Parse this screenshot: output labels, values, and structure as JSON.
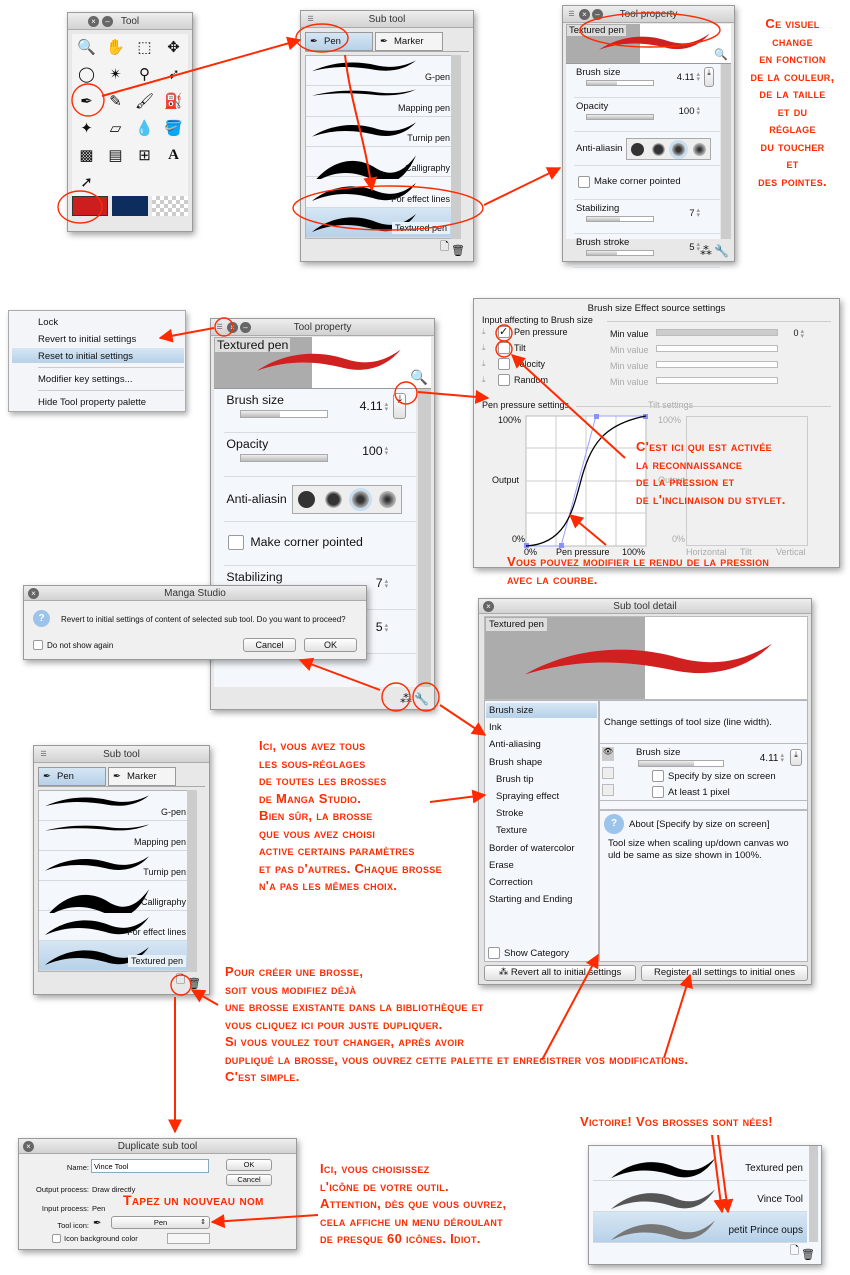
{
  "colors": {
    "annotation": "#ff2a00",
    "brush_red": "#d02020",
    "foreground": "#cc1e1e",
    "background": "#0c2d5e",
    "selection": "#c3d9ee"
  },
  "tool_palette": {
    "title": "Tool",
    "icons": [
      "zoom-icon",
      "hand-icon",
      "object-icon",
      "move-icon",
      "lasso-icon",
      "magic-wand-icon",
      "eyedropper-icon",
      "cursor-icon",
      "pen-icon",
      "pencil-icon",
      "brush-icon",
      "airbrush-icon",
      "decoration-icon",
      "eraser-icon",
      "blend-icon",
      "fill-icon",
      "gradient-icon",
      "figure-icon",
      "frame-icon",
      "text-icon",
      "correct-line-icon"
    ],
    "text_glyph": "A"
  },
  "sub_tool_top": {
    "title": "Sub tool",
    "tabs": [
      "Pen",
      "Marker"
    ],
    "items": [
      "G-pen",
      "Mapping pen",
      "Turnip pen",
      "Calligraphy",
      "For effect lines",
      "Textured pen"
    ],
    "selected": "Textured pen"
  },
  "tool_property": {
    "title": "Tool property",
    "preview_label": "Textured pen",
    "brush_size_label": "Brush size",
    "brush_size": "4.11",
    "brush_size_fill": 0.45,
    "opacity_label": "Opacity",
    "opacity": "100",
    "opacity_fill": 1.0,
    "anti_alias_label": "Anti-aliasin",
    "anti_alias_selected": 3,
    "corner_label": "Make corner pointed",
    "stabilizing_label": "Stabilizing",
    "stabilizing": "7",
    "stabilizing_fill": 0.5,
    "stroke_label": "Brush stroke",
    "stroke": "5",
    "stroke_fill": 0.45
  },
  "annotation_top": [
    "Ce visuel",
    "change",
    "en fonction",
    "de la couleur,",
    "de la taille",
    "et du",
    "réglage",
    "du toucher",
    "et",
    "des pointes."
  ],
  "menu": {
    "items": [
      "Lock",
      "Revert to initial settings",
      "Reset to initial settings",
      "Modifier key settings...",
      "Hide Tool property palette"
    ],
    "highlighted": "Reset to initial settings"
  },
  "effect_source": {
    "title": "Brush size Effect source settings",
    "group": "Input affecting to Brush size",
    "inputs": [
      {
        "label": "Pen pressure",
        "checked": true,
        "min_label": "Min value",
        "min": "0"
      },
      {
        "label": "Tilt",
        "checked": false,
        "min_label": "Min value"
      },
      {
        "label": "Velocity",
        "checked": false,
        "min_label": "Min value"
      },
      {
        "label": "Random",
        "checked": false,
        "min_label": "Min value"
      }
    ],
    "pressure_title": "Pen pressure settings",
    "tilt_title": "Tilt settings",
    "y_max": "100%",
    "y_label": "Output",
    "y_min": "0%",
    "x_min": "0%",
    "x_label": "Pen pressure",
    "x_max": "100%",
    "tilt_y_max": "100%",
    "tilt_y_label": "Output",
    "tilt_y_min": "0%",
    "tilt_x": [
      "Horizontal",
      "Tilt",
      "Vertical"
    ]
  },
  "annotation_pressure": [
    "C'est ici qui est activée",
    "la reconnaissance",
    "de la pression et",
    "de l'inclinaison du stylet."
  ],
  "annotation_curve": [
    "Vous pouvez modifier le rendu de la pression",
    "avec la courbe."
  ],
  "confirm_dialog": {
    "title": "Manga Studio",
    "message": "Revert to initial settings of content of selected sub tool.  Do you want to proceed?",
    "checkbox": "Do not show again",
    "cancel": "Cancel",
    "ok": "OK"
  },
  "sub_tool_detail": {
    "title": "Sub tool detail",
    "preview_label": "Textured pen",
    "categories": [
      "Brush size",
      "Ink",
      "Anti-aliasing",
      "Brush shape",
      "Brush tip",
      "Spraying effect",
      "Stroke",
      "Texture",
      "Border of watercolor",
      "Erase",
      "Correction",
      "Starting and Ending"
    ],
    "selected": "Brush size",
    "description": "Change settings of tool size (line width).",
    "brush_size_label": "Brush size",
    "brush_size": "4.11",
    "opt1": "Specify by size on screen",
    "opt2": "At least 1 pixel",
    "about_title": "About [Specify by size on screen]",
    "about_text1": "Tool size when scaling up/down canvas wo",
    "about_text2": "uld be same as size shown in 100%.",
    "show_category": "Show Category",
    "revert_btn": "Revert all to initial settings",
    "register_btn": "Register all settings to initial ones"
  },
  "annotation_detail": [
    "Ici, vous avez tous",
    "les sous-réglages",
    "de toutes les brosses",
    "de Manga Studio.",
    "Bien sûr, la brosse",
    "que vous avez choisi",
    "active certains paramètres",
    "et pas d'autres. Chaque brosse",
    "n'a pas les mêmes choix."
  ],
  "sub_tool_bottom": {
    "title": "Sub tool",
    "tabs": [
      "Pen",
      "Marker"
    ],
    "items": [
      "G-pen",
      "Mapping pen",
      "Turnip pen",
      "Calligraphy",
      "For effect lines",
      "Textured pen"
    ],
    "selected": "Textured pen"
  },
  "annotation_create": [
    "Pour créer une brosse,",
    "soit vous modifiez déjà",
    "une brosse existante dans la bibliothèque et",
    "vous cliquez ici pour juste dupliquer.",
    "Si vous voulez tout changer, après avoir",
    "dupliqué la brosse,  vous ouvrez cette palette et enregistrer vos modifications.",
    "C'est simple."
  ],
  "duplicate_dialog": {
    "title": "Duplicate sub tool",
    "name_label": "Name:",
    "name_value": "Vince Tool",
    "output_label": "Output process:",
    "output_value": "Draw directly",
    "input_label": "Input process:",
    "input_value": "Pen",
    "icon_label": "Tool icon:",
    "icon_value": "Pen",
    "bg_label": "Icon background color",
    "ok": "OK",
    "cancel": "Cancel"
  },
  "annotation_name": "Tapez un nouveau nom",
  "annotation_icon": [
    "Ici, vous choisissez",
    "l'icône de votre outil.",
    "Attention, dès que vous ouvrez,",
    "cela affiche un menu déroulant",
    "de presque 60 icônes. Idiot."
  ],
  "annotation_victory": "Victoire! Vos brosses sont nées!",
  "result_list": {
    "items": [
      "Textured pen",
      "Vince Tool",
      "petit Prince oups"
    ],
    "selected": "petit Prince oups"
  }
}
